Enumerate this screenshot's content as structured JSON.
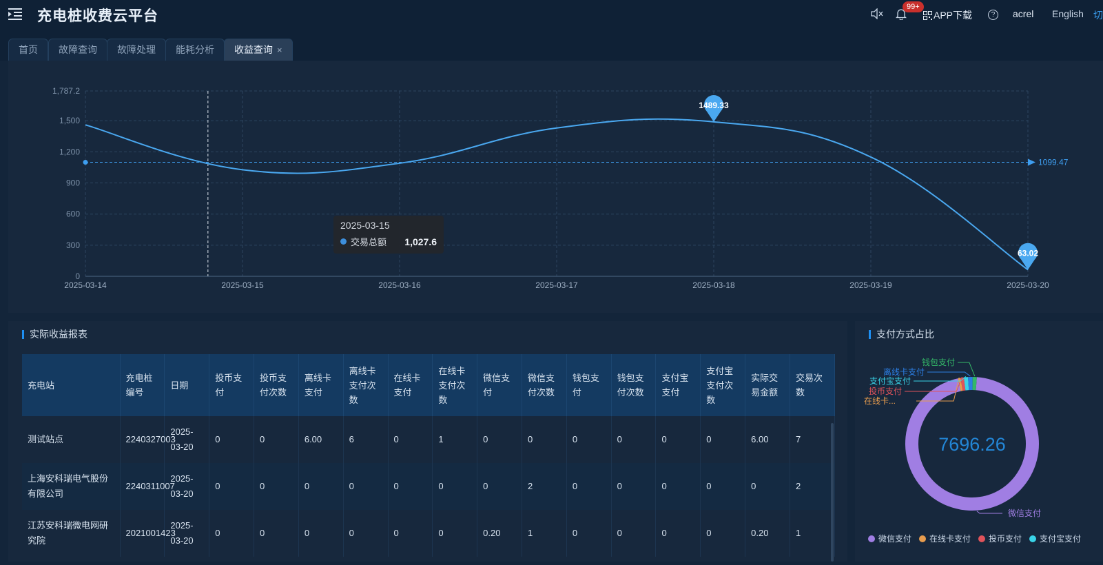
{
  "header": {
    "app_title": "充电桩收费云平台",
    "badge": "99+",
    "app_download": "APP下载",
    "user": "acrel",
    "lang": "English",
    "switch": "切"
  },
  "tabs": [
    {
      "label": "首页"
    },
    {
      "label": "故障查询"
    },
    {
      "label": "故障处理"
    },
    {
      "label": "能耗分析"
    },
    {
      "label": "收益查询",
      "close": "×"
    }
  ],
  "chart_data": {
    "type": "line",
    "categories": [
      "2025-03-14",
      "2025-03-15",
      "2025-03-16",
      "2025-03-17",
      "2025-03-18",
      "2025-03-19",
      "2025-03-20"
    ],
    "series": [
      {
        "name": "交易总额",
        "values": [
          1460,
          1027.6,
          1090,
          1430,
          1489.33,
          1150,
          63.02
        ]
      }
    ],
    "y_ticks": [
      "0",
      "300",
      "600",
      "900",
      "1,200",
      "1,500",
      "1,787.2"
    ],
    "ylim": [
      0,
      1787.2
    ],
    "max_label": "1489.33",
    "min_label": "63.02",
    "avg_value": 1099.47,
    "avg_label": "1099.47",
    "color": "#4aa8f0",
    "tooltip": {
      "date": "2025-03-15",
      "series": "交易总额",
      "value": "1,027.6"
    }
  },
  "report": {
    "title": "实际收益报表",
    "columns": [
      "充电站",
      "充电桩编号",
      "日期",
      "投币支付",
      "投币支付次数",
      "离线卡支付",
      "离线卡支付次数",
      "在线卡支付",
      "在线卡支付次数",
      "微信支付",
      "微信支付次数",
      "钱包支付",
      "钱包支付次数",
      "支付宝支付",
      "支付宝支付次数",
      "实际交易金额",
      "交易次数"
    ],
    "rows": [
      [
        "测试站点",
        "2240327003",
        "2025-03-20",
        "0",
        "0",
        "6.00",
        "6",
        "0",
        "1",
        "0",
        "0",
        "0",
        "0",
        "0",
        "0",
        "6.00",
        "7"
      ],
      [
        "上海安科瑞电气股份有限公司",
        "2240311007",
        "2025-03-20",
        "0",
        "0",
        "0",
        "0",
        "0",
        "0",
        "0",
        "2",
        "0",
        "0",
        "0",
        "0",
        "0",
        "2"
      ],
      [
        "江苏安科瑞微电网研究院",
        "2021001423",
        "2025-03-20",
        "0",
        "0",
        "0",
        "0",
        "0",
        "0",
        "0.20",
        "1",
        "0",
        "0",
        "0",
        "0",
        "0.20",
        "1"
      ]
    ]
  },
  "pie": {
    "title": "支付方式占比",
    "center": "7696.26",
    "slices": [
      {
        "name": "微信支付",
        "label": "微信支付",
        "value": 0.955,
        "color": "#a07ee3"
      },
      {
        "name": "在线卡支付",
        "label": "在线卡...",
        "value": 0.006,
        "color": "#e79c4e"
      },
      {
        "name": "投币支付",
        "label": "投币支付",
        "value": 0.008,
        "color": "#e0535b"
      },
      {
        "name": "支付宝支付",
        "label": "支付宝支付",
        "value": 0.01,
        "color": "#39d3e8"
      },
      {
        "name": "离线卡支付",
        "label": "离线卡支付",
        "value": 0.011,
        "color": "#2c7fe4"
      },
      {
        "name": "钱包支付",
        "label": "钱包支付",
        "value": 0.01,
        "color": "#34b868"
      }
    ],
    "legend": [
      "微信支付",
      "在线卡支付",
      "投币支付",
      "支付宝支付"
    ]
  }
}
